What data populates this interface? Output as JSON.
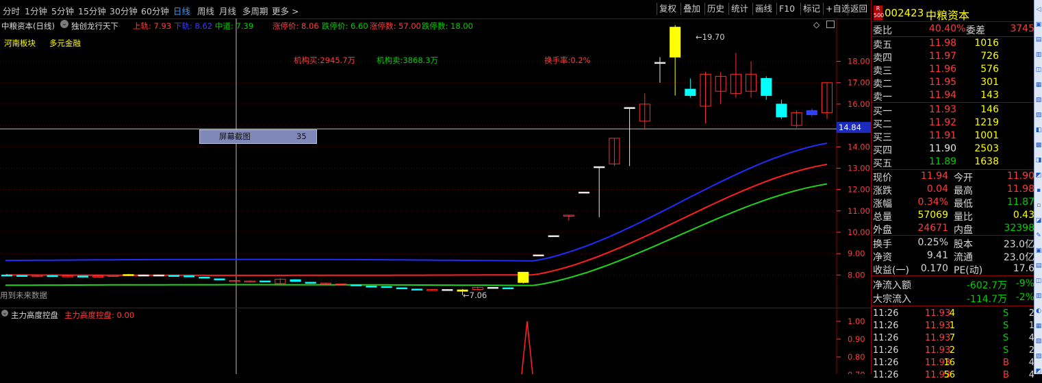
{
  "toolbar": {
    "periods": [
      "分时",
      "1分钟",
      "5分钟",
      "15分钟",
      "30分钟",
      "60分钟",
      "日线",
      "周线",
      "月线",
      "多周期",
      "更多 >"
    ],
    "active_period": "日线",
    "buttons": [
      "复权",
      "叠加",
      "历史",
      "统计",
      "画线",
      "F10",
      "标记",
      "+自选",
      "返回"
    ]
  },
  "chart": {
    "stock_title": "中粮资本(日线)",
    "indicator_name": "独创龙行天下",
    "legend": {
      "upper": "上轨: 7.93",
      "lower": "下轨: 8.62",
      "mid": "中道: 7.39",
      "limit_up_price": "涨停价: 8.06",
      "limit_down_price": "跌停价: 6.60",
      "limit_up_count": "涨停数: 57.00",
      "limit_down_count": "跌停数: 18.00"
    },
    "sectors": [
      "河南板块",
      "多元金融"
    ],
    "inst_buy": "机构买:2945.7万",
    "inst_sell": "机构卖:3868.3万",
    "turnover": "换手率:0.2%",
    "crosshair_price": "14.84",
    "tooltip_label": "屏幕截图",
    "tooltip_value": "35",
    "high_mark": "19.70",
    "low_mark": "7.06",
    "future_note": "用到未来数据",
    "price_ticks": [
      "18.00",
      "17.00",
      "16.00",
      "15.00",
      "14.00",
      "13.00",
      "12.00",
      "11.00",
      "10.00",
      "9.00",
      "8.00"
    ],
    "sub_indicator": "主力高度控盘",
    "sub_legend": "主力高度控盘: 0.00",
    "sub_ticks": [
      "1.00",
      "0.90",
      "0.80",
      "0.70"
    ]
  },
  "panel": {
    "badge_top": "R",
    "badge_bottom": "500",
    "code": "002423",
    "name": "中粮资本",
    "weibi_label": "委比",
    "weibi_value": "40.40%",
    "weicha_label": "委差",
    "weicha_value": "3745",
    "asks": [
      {
        "label": "卖五",
        "price": "11.98",
        "vol": "1016"
      },
      {
        "label": "卖四",
        "price": "11.97",
        "vol": "726"
      },
      {
        "label": "卖三",
        "price": "11.96",
        "vol": "576"
      },
      {
        "label": "卖二",
        "price": "11.95",
        "vol": "301"
      },
      {
        "label": "卖一",
        "price": "11.94",
        "vol": "143"
      }
    ],
    "bids": [
      {
        "label": "买一",
        "price": "11.93",
        "vol": "146"
      },
      {
        "label": "买二",
        "price": "11.92",
        "vol": "1219"
      },
      {
        "label": "买三",
        "price": "11.91",
        "vol": "1001"
      },
      {
        "label": "买四",
        "price": "11.90",
        "vol": "2503"
      },
      {
        "label": "买五",
        "price": "11.89",
        "vol": "1638"
      }
    ],
    "quote": [
      {
        "l1": "现价",
        "v1": "11.94",
        "l2": "今开",
        "v2": "11.90"
      },
      {
        "l1": "涨跌",
        "v1": "0.04",
        "l2": "最高",
        "v2": "11.98"
      },
      {
        "l1": "涨幅",
        "v1": "0.34%",
        "l2": "最低",
        "v2": "11.87"
      },
      {
        "l1": "总量",
        "v1": "57069",
        "l2": "量比",
        "v2": "0.43"
      },
      {
        "l1": "外盘",
        "v1": "24671",
        "l2": "内盘",
        "v2": "32398"
      }
    ],
    "fund": [
      {
        "l1": "换手",
        "v1": "0.25%",
        "l2": "股本",
        "v2": "23.0亿"
      },
      {
        "l1": "净资",
        "v1": "9.41",
        "l2": "流通",
        "v2": "23.0亿"
      },
      {
        "l1": "收益(一)",
        "v1": "0.170",
        "l2": "PE(动)",
        "v2": "17.6"
      }
    ],
    "flow": [
      {
        "label": "净流入额",
        "value": "-602.7万",
        "pct": "-9%"
      },
      {
        "label": "大宗流入",
        "value": "-114.7万",
        "pct": "-2%"
      }
    ],
    "ticks": [
      {
        "time": "11:26",
        "price": "11.93",
        "vol": "4",
        "side": "S",
        "n": "2"
      },
      {
        "time": "11:26",
        "price": "11.93",
        "vol": "1",
        "side": "S",
        "n": "1"
      },
      {
        "time": "11:26",
        "price": "11.93",
        "vol": "7",
        "side": "S",
        "n": "4"
      },
      {
        "time": "11:26",
        "price": "11.93",
        "vol": "2",
        "side": "S",
        "n": "2"
      },
      {
        "time": "11:26",
        "price": "11.93",
        "vol": "16",
        "side": "B",
        "n": "4"
      },
      {
        "time": "11:26",
        "price": "11.93",
        "vol": "56",
        "side": "B",
        "n": "4"
      }
    ]
  },
  "chart_data": {
    "type": "candlestick",
    "note": "Daily candles with upper/mid/lower bands",
    "candles": [
      {
        "o": 8.0,
        "c": 8.0,
        "h": 8.05,
        "l": 7.95,
        "col": "cyan"
      },
      {
        "o": 7.98,
        "c": 7.95,
        "h": 8.0,
        "l": 7.93,
        "col": "cyan"
      },
      {
        "o": 7.95,
        "c": 7.97,
        "h": 8.0,
        "l": 7.93,
        "col": "red"
      },
      {
        "o": 7.97,
        "c": 7.94,
        "h": 8.0,
        "l": 7.92,
        "col": "cyan"
      },
      {
        "o": 7.93,
        "c": 7.96,
        "h": 7.98,
        "l": 7.9,
        "col": "red"
      },
      {
        "o": 7.95,
        "c": 7.93,
        "h": 7.97,
        "l": 7.9,
        "col": "cyan"
      },
      {
        "o": 7.92,
        "c": 7.95,
        "h": 7.98,
        "l": 7.9,
        "col": "red"
      },
      {
        "o": 7.96,
        "c": 7.98,
        "h": 8.0,
        "l": 7.94,
        "col": "red"
      },
      {
        "o": 7.98,
        "c": 8.02,
        "h": 8.05,
        "l": 7.95,
        "col": "yellow"
      },
      {
        "o": 8.0,
        "c": 8.0,
        "h": 8.02,
        "l": 7.96,
        "col": "white"
      },
      {
        "o": 7.98,
        "c": 8.0,
        "h": 8.02,
        "l": 7.96,
        "col": "white"
      },
      {
        "o": 7.98,
        "c": 7.96,
        "h": 8.0,
        "l": 7.94,
        "col": "cyan"
      },
      {
        "o": 7.96,
        "c": 7.95,
        "h": 7.98,
        "l": 7.92,
        "col": "cyan"
      },
      {
        "o": 7.9,
        "c": 7.86,
        "h": 7.92,
        "l": 7.84,
        "col": "cyan"
      },
      {
        "o": 7.82,
        "c": 7.8,
        "h": 7.84,
        "l": 7.78,
        "col": "cyan"
      },
      {
        "o": 7.74,
        "c": 7.72,
        "h": 7.76,
        "l": 7.7,
        "col": "red"
      },
      {
        "o": 7.7,
        "c": 7.72,
        "h": 7.74,
        "l": 7.68,
        "col": "red"
      },
      {
        "o": 7.72,
        "c": 7.68,
        "h": 7.74,
        "l": 7.66,
        "col": "cyan"
      },
      {
        "o": 7.6,
        "c": 7.8,
        "h": 7.85,
        "l": 7.55,
        "col": "red"
      },
      {
        "o": 7.78,
        "c": 7.7,
        "h": 7.8,
        "l": 7.68,
        "col": "cyan"
      },
      {
        "o": 7.66,
        "c": 7.64,
        "h": 7.68,
        "l": 7.62,
        "col": "cyan"
      },
      {
        "o": 7.62,
        "c": 7.6,
        "h": 7.64,
        "l": 7.58,
        "col": "red"
      },
      {
        "o": 7.58,
        "c": 7.56,
        "h": 7.6,
        "l": 7.54,
        "col": "red"
      },
      {
        "o": 7.54,
        "c": 7.5,
        "h": 7.56,
        "l": 7.48,
        "col": "cyan"
      },
      {
        "o": 7.48,
        "c": 7.46,
        "h": 7.5,
        "l": 7.44,
        "col": "cyan"
      },
      {
        "o": 7.46,
        "c": 7.42,
        "h": 7.48,
        "l": 7.4,
        "col": "cyan"
      },
      {
        "o": 7.4,
        "c": 7.36,
        "h": 7.42,
        "l": 7.34,
        "col": "cyan"
      },
      {
        "o": 7.34,
        "c": 7.32,
        "h": 7.36,
        "l": 7.3,
        "col": "cyan"
      },
      {
        "o": 7.3,
        "c": 7.32,
        "h": 7.34,
        "l": 7.28,
        "col": "red"
      },
      {
        "o": 7.32,
        "c": 7.3,
        "h": 7.34,
        "l": 7.26,
        "col": "white"
      },
      {
        "o": 7.24,
        "c": 7.3,
        "h": 7.34,
        "l": 7.06,
        "col": "yellow"
      },
      {
        "o": 7.32,
        "c": 7.42,
        "h": 7.46,
        "l": 7.3,
        "col": "red"
      },
      {
        "o": 7.42,
        "c": 7.4,
        "h": 7.44,
        "l": 7.36,
        "col": "white"
      },
      {
        "o": 7.38,
        "c": 7.4,
        "h": 7.42,
        "l": 7.36,
        "col": "cyan"
      },
      {
        "o": 7.65,
        "c": 8.13,
        "h": 8.13,
        "l": 7.6,
        "col": "yellow"
      },
      {
        "o": 8.94,
        "c": 8.94,
        "h": 8.94,
        "l": 8.94,
        "col": "white"
      },
      {
        "o": 9.84,
        "c": 9.84,
        "h": 9.84,
        "l": 9.84,
        "col": "white"
      },
      {
        "o": 10.76,
        "c": 10.8,
        "h": 10.82,
        "l": 10.55,
        "col": "red"
      },
      {
        "o": 11.88,
        "c": 11.88,
        "h": 11.88,
        "l": 11.88,
        "col": "white"
      },
      {
        "o": 13.07,
        "c": 13.07,
        "h": 13.07,
        "l": 10.7,
        "col": "white"
      },
      {
        "o": 13.2,
        "c": 14.4,
        "h": 14.4,
        "l": 13.1,
        "col": "red"
      },
      {
        "o": 15.84,
        "c": 15.84,
        "h": 15.84,
        "l": 13.1,
        "col": "white"
      },
      {
        "o": 15.2,
        "c": 16.0,
        "h": 16.5,
        "l": 14.8,
        "col": "red"
      },
      {
        "o": 17.95,
        "c": 17.95,
        "h": 18.2,
        "l": 17.0,
        "col": "white"
      },
      {
        "o": 18.2,
        "c": 19.6,
        "h": 19.7,
        "l": 16.4,
        "col": "yellow"
      },
      {
        "o": 16.7,
        "c": 16.4,
        "h": 17.2,
        "l": 16.3,
        "col": "cyan"
      },
      {
        "o": 15.9,
        "c": 17.4,
        "h": 17.5,
        "l": 15.1,
        "col": "red"
      },
      {
        "o": 16.6,
        "c": 17.3,
        "h": 17.5,
        "l": 16.0,
        "col": "red"
      },
      {
        "o": 16.5,
        "c": 17.4,
        "h": 18.4,
        "l": 16.3,
        "col": "red"
      },
      {
        "o": 16.6,
        "c": 17.4,
        "h": 18.0,
        "l": 16.3,
        "col": "red"
      },
      {
        "o": 17.2,
        "c": 16.4,
        "h": 17.3,
        "l": 16.2,
        "col": "cyan"
      },
      {
        "o": 16.0,
        "c": 15.4,
        "h": 16.2,
        "l": 15.3,
        "col": "cyan"
      },
      {
        "o": 15.0,
        "c": 15.6,
        "h": 15.7,
        "l": 14.9,
        "col": "red"
      },
      {
        "o": 15.7,
        "c": 15.5,
        "h": 15.8,
        "l": 15.4,
        "col": "blue"
      },
      {
        "o": 15.6,
        "c": 17.0,
        "h": 17.0,
        "l": 15.3,
        "col": "red"
      }
    ],
    "upper_band_start": 8.68,
    "upper_band_end": 14.17,
    "mid_band_start": 8.0,
    "mid_band_end": 13.18,
    "lower_band_start": 7.52,
    "lower_band_end": 12.26,
    "ylim": [
      7.0,
      19.8
    ]
  }
}
